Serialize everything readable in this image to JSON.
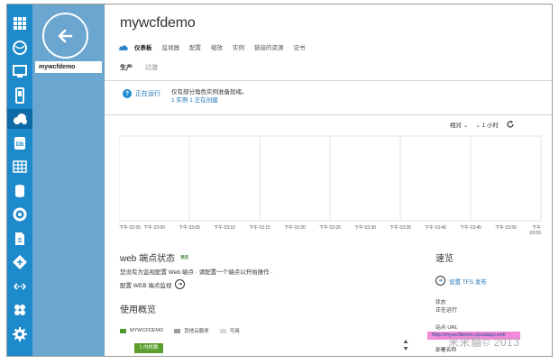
{
  "app": {
    "title": "mywcfdemo"
  },
  "subnav": {
    "item": "mywcfdemo"
  },
  "rail": {
    "icons": [
      "all-items-icon",
      "websites-icon",
      "virtual-machines-icon",
      "mobile-services-icon",
      "cloud-services-icon",
      "sql-databases-icon",
      "storage-icon",
      "hdinsight-icon",
      "media-services-icon",
      "service-bus-icon",
      "visual-studio-online-icon",
      "networks-icon",
      "traffic-manager-icon",
      "settings-icon"
    ],
    "active_index": 4
  },
  "tabs": [
    "仪表板",
    "监视器",
    "配置",
    "缩放",
    "实例",
    "链接的资源",
    "证书"
  ],
  "environment": {
    "production": "生产",
    "staging": "过渡"
  },
  "status": {
    "label": "正在运行",
    "message": "仅有部分角色实例准备就绪。",
    "link": "1 实例 1 正在创建"
  },
  "chart_controls": {
    "metric": "相对",
    "range": "1 小时"
  },
  "chart_data": {
    "type": "line",
    "categories": [
      "下午 02:55",
      "下午 03:00",
      "下午 03:05",
      "下午 03:10",
      "下午 03:15",
      "下午 03:20",
      "下午 03:25",
      "下午 03:30",
      "下午 03:35",
      "下午 03:40",
      "下午 03:45",
      "下午 03:50",
      "下午 03:55"
    ],
    "series": [],
    "grid": true
  },
  "web_endpoint": {
    "title": "web 端点状态",
    "badge": "预览",
    "text": "您没有为监视配置 Web 端点 · 请配置一个端点以开始操作 ·",
    "configure": "配置 WEB 端点监视"
  },
  "usage": {
    "title": "使用概览",
    "legend": [
      "MYWCFDEMO",
      "其他云服务",
      "可用"
    ],
    "colors": [
      "#4f9a2a",
      "#9c9c9c",
      "#d9d9d9"
    ],
    "cores_label": "1 内核数"
  },
  "quick_glance": {
    "title": "速览",
    "tfs": "设置 TFS 发布",
    "status_label": "状态",
    "status_value": "正在运行",
    "site_url_label": "站点 URL",
    "site_url": "http://mywcfdemo.cloudapp.net/",
    "deploy_label": "部署名称"
  },
  "watermark": "米米貓© 2013"
}
